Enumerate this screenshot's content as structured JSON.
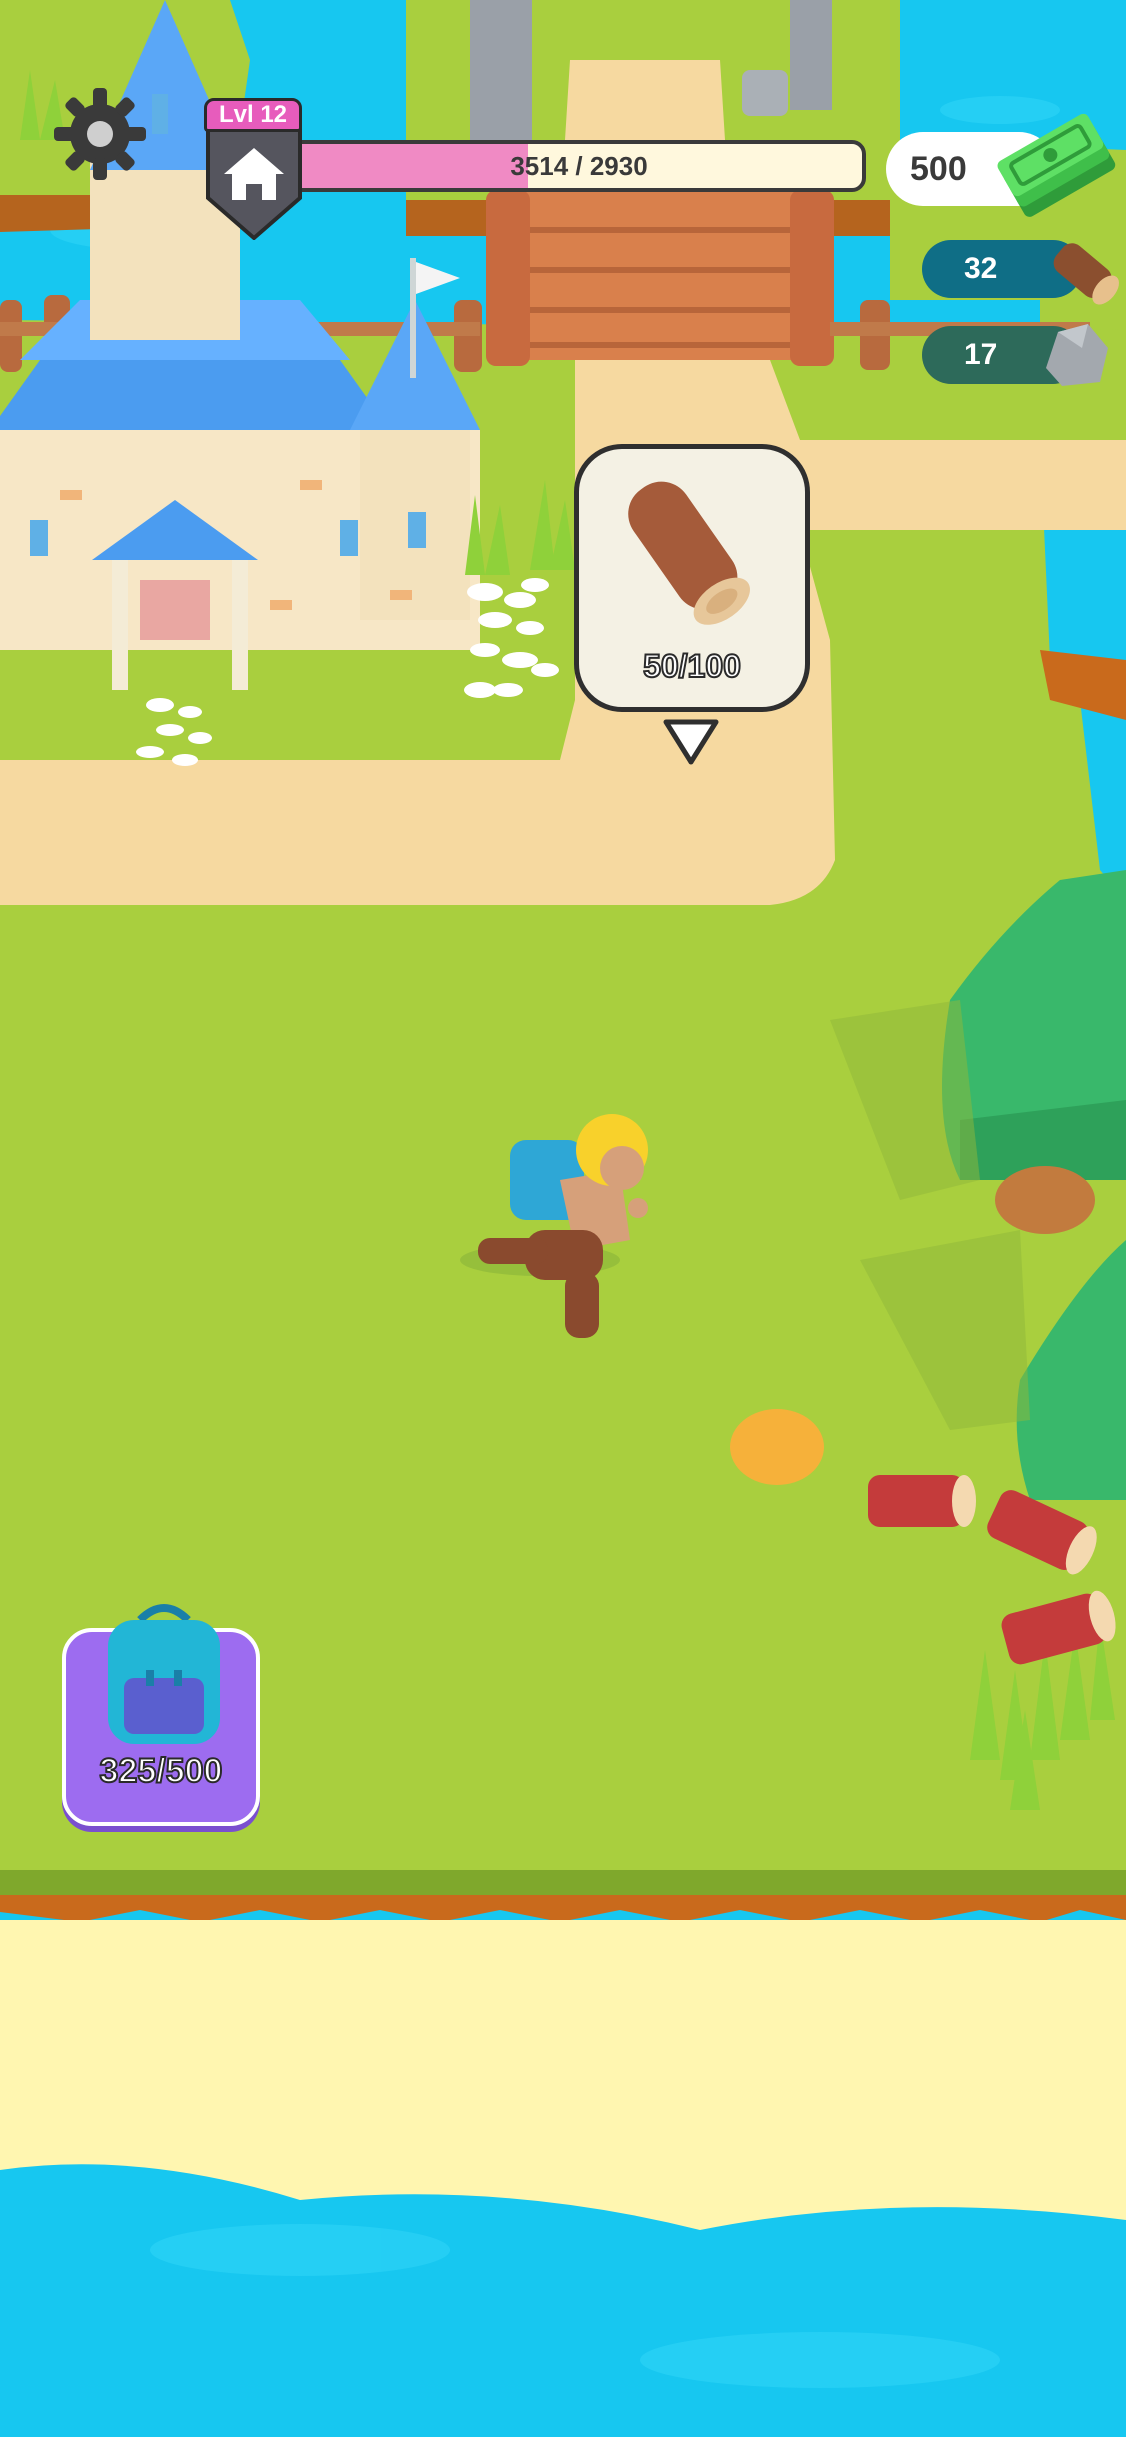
{
  "hud": {
    "level_label": "Lvl 12",
    "xp_current": "3514",
    "xp_separator": "/",
    "xp_max": "2930",
    "xp_text": "3514 / 2930",
    "xp_fill_fraction": 0.41,
    "cash_value": "500",
    "wood_count": "32",
    "stone_count": "17"
  },
  "task": {
    "progress_text": "50/100",
    "resource_icon": "log-icon"
  },
  "backpack": {
    "capacity_text": "325/500",
    "icon": "backpack-icon"
  },
  "icons": {
    "settings": "gear-icon",
    "home": "home-icon",
    "cash": "cash-stack-icon",
    "wood": "wood-log-icon",
    "stone": "stone-icon"
  },
  "colors": {
    "water": "#17c7f0",
    "grass": "#a9cf3e",
    "sand": "#f6d9a0",
    "beach": "#fff6b0",
    "xp_fill": "#f08ac4",
    "level_tag": "#e75cbc",
    "backpack_button": "#9d6cf0"
  }
}
